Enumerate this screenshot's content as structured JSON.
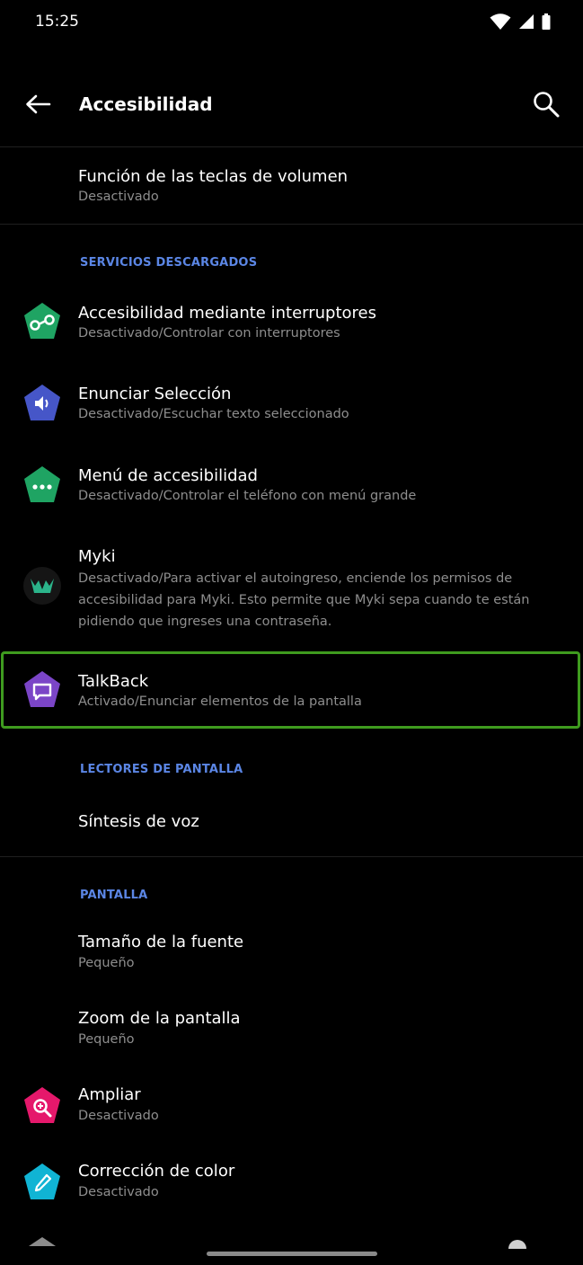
{
  "status_bar": {
    "time": "15:25"
  },
  "app_bar": {
    "title": "Accesibilidad"
  },
  "items_top": {
    "volume_keys": {
      "title": "Función de las teclas de volumen",
      "subtitle": "Desactivado"
    }
  },
  "sections": {
    "downloaded": "SERVICIOS DESCARGADOS",
    "screen_readers": "LECTORES DE PANTALLA",
    "display": "PANTALLA"
  },
  "downloaded_services": [
    {
      "title": "Accesibilidad mediante interruptores",
      "subtitle": "Desactivado/Controlar con interruptores",
      "icon": "switch-access-icon",
      "color": "#1fa463"
    },
    {
      "title": "Enunciar Selección",
      "subtitle": "Desactivado/Escuchar texto seleccionado",
      "icon": "select-to-speak-icon",
      "color": "#4656c8"
    },
    {
      "title": "Menú de accesibilidad",
      "subtitle": "Desactivado/Controlar el teléfono con menú grande",
      "icon": "accessibility-menu-icon",
      "color": "#1fa463"
    },
    {
      "title": "Myki",
      "subtitle": "Desactivado/Para activar el autoingreso, enciende los permisos de accesibilidad para Myki. Esto permite que Myki sepa cuando te están pidiendo que ingreses una contraseña.",
      "icon": "myki-icon",
      "color": "#2bb48a"
    },
    {
      "title": "TalkBack",
      "subtitle": "Activado/Enunciar elementos de la pantalla",
      "icon": "talkback-icon",
      "color": "#7b45c7"
    }
  ],
  "screen_readers": {
    "tts": {
      "title": "Síntesis de voz"
    }
  },
  "display_items": [
    {
      "title": "Tamaño de la fuente",
      "subtitle": "Pequeño"
    },
    {
      "title": "Zoom de la pantalla",
      "subtitle": "Pequeño"
    },
    {
      "title": "Ampliar",
      "subtitle": "Desactivado",
      "icon": "magnification-icon",
      "color": "#e5186b"
    },
    {
      "title": "Corrección de color",
      "subtitle": "Desactivado",
      "icon": "color-correction-icon",
      "color": "#10b4d4"
    }
  ],
  "colors": {
    "accent": "#5b86e5",
    "highlight": "#3f9b1f"
  }
}
